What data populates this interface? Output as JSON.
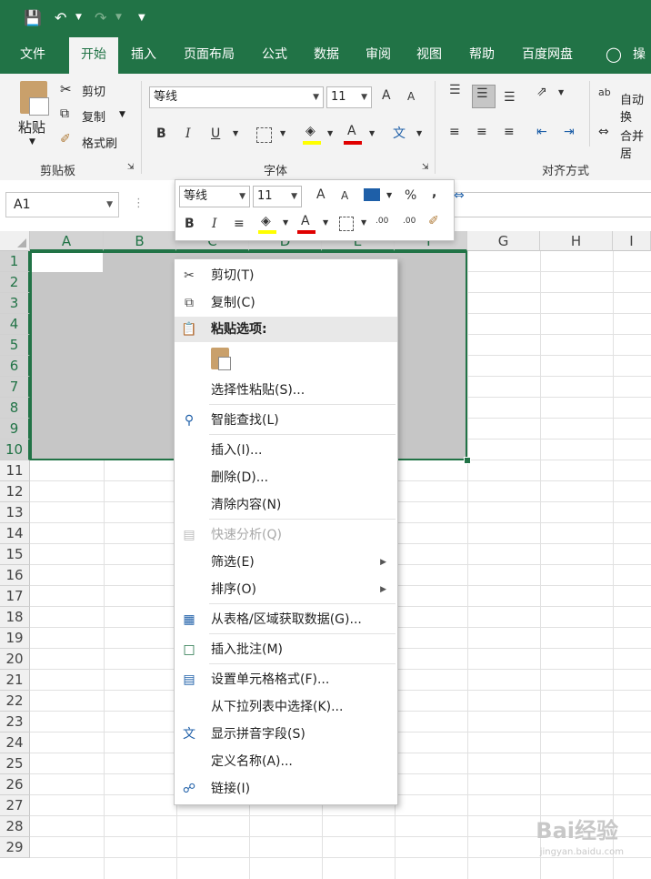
{
  "qat": {
    "save_icon": "save-icon",
    "undo_icon": "undo-icon",
    "redo_icon": "redo-icon",
    "customize_icon": "customize-qat-icon"
  },
  "tabs": [
    {
      "label": "文件"
    },
    {
      "label": "开始"
    },
    {
      "label": "插入"
    },
    {
      "label": "页面布局"
    },
    {
      "label": "公式"
    },
    {
      "label": "数据"
    },
    {
      "label": "审阅"
    },
    {
      "label": "视图"
    },
    {
      "label": "帮助"
    },
    {
      "label": "百度网盘"
    },
    {
      "label": "操作"
    }
  ],
  "active_tab": "开始",
  "ribbon": {
    "clipboard": {
      "paste": "粘贴",
      "cut": "剪切",
      "copy": "复制",
      "format_painter": "格式刷",
      "label": "剪贴板"
    },
    "font": {
      "font_name": "等线",
      "font_size": "11",
      "label": "字体",
      "bold": "B",
      "italic": "I",
      "underline": "U",
      "grow": "A",
      "shrink": "A",
      "color_letter": "A",
      "pinyin": "文"
    },
    "alignment": {
      "wrap": "自动换",
      "merge": "合并居",
      "label": "对齐方式"
    }
  },
  "formula_bar": {
    "name_box": "A1"
  },
  "colors": {
    "excel_green": "#217346",
    "selection": "#c6c6c6",
    "fill_yellow": "#ffff00",
    "font_red": "#e00000"
  },
  "mini_toolbar": {
    "font_name": "等线",
    "font_size": "11",
    "percent": "%",
    "comma": ",",
    "bold": "B",
    "italic": "I",
    "color_letter": "A",
    "inc_decimal": ".00",
    "dec_decimal": ".00"
  },
  "grid": {
    "columns": [
      "A",
      "B",
      "C",
      "D",
      "E",
      "F",
      "G",
      "H",
      "I"
    ],
    "rows": [
      "1",
      "2",
      "3",
      "4",
      "5",
      "6",
      "7",
      "8",
      "9",
      "10",
      "11",
      "12",
      "13",
      "14",
      "15",
      "16",
      "17",
      "18",
      "19",
      "20",
      "21",
      "22",
      "23",
      "24",
      "25",
      "26",
      "27",
      "28",
      "29"
    ]
  },
  "context_menu": {
    "cut": "剪切(T)",
    "copy": "复制(C)",
    "paste_options": "粘贴选项:",
    "paste_special": "选择性粘贴(S)...",
    "smart_lookup": "智能查找(L)",
    "insert": "插入(I)...",
    "delete": "删除(D)...",
    "clear": "清除内容(N)",
    "quick_analysis": "快速分析(Q)",
    "filter": "筛选(E)",
    "sort": "排序(O)",
    "get_data": "从表格/区域获取数据(G)...",
    "insert_comment": "插入批注(M)",
    "format_cells": "设置单元格格式(F)...",
    "pick_list": "从下拉列表中选择(K)...",
    "show_pinyin": "显示拼音字段(S)",
    "define_name": "定义名称(A)...",
    "link": "链接(I)"
  },
  "watermark": {
    "brand": "Bai经验",
    "url": "jingyan.baidu.com"
  }
}
